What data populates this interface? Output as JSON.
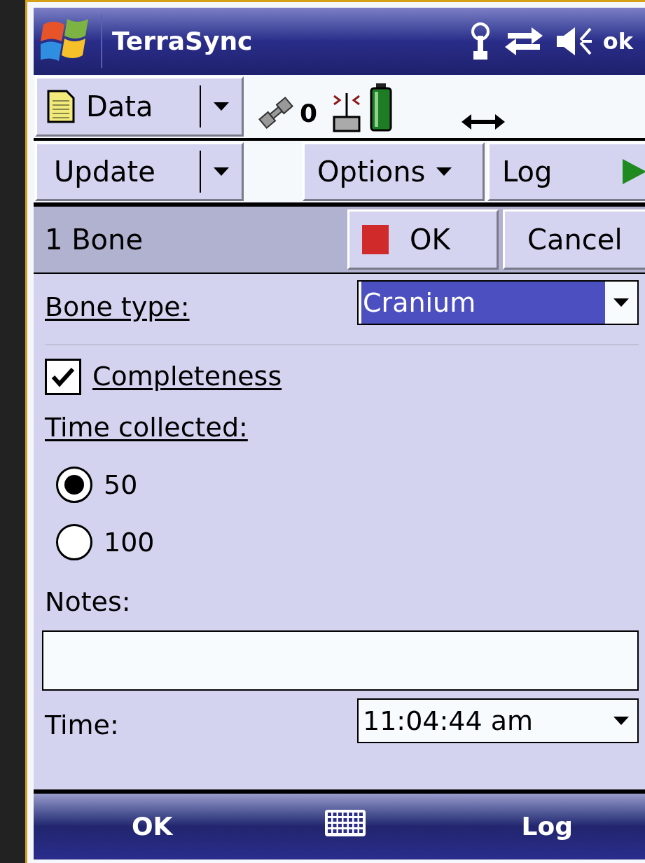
{
  "title_bar": {
    "title": "TerraSync",
    "status_text": "ok"
  },
  "toolbar": {
    "data_menu": "Data",
    "satellite_count": "0",
    "update_menu": "Update",
    "options_menu": "Options",
    "log_button": "Log"
  },
  "feature_header": {
    "title": "1 Bone",
    "ok": "OK",
    "cancel": "Cancel"
  },
  "form": [
    {
      "kind": "dropdown",
      "label": "Bone type:",
      "underlined": true,
      "value": "Cranium",
      "highlighted": true
    },
    {
      "kind": "checkbox",
      "label": "Completeness",
      "underlined": true,
      "checked": true
    },
    {
      "kind": "radio",
      "label": "Time collected:",
      "underlined": true,
      "options": [
        {
          "label": "50",
          "selected": true
        },
        {
          "label": "100",
          "selected": false
        }
      ]
    },
    {
      "kind": "text",
      "label": "Notes:",
      "underlined": false
    },
    {
      "kind": "dropdown",
      "label": "Time:",
      "underlined": false,
      "value": "11:04:44 am",
      "highlighted": false
    }
  ],
  "soft_keys": {
    "left": "OK",
    "right": "Log"
  }
}
